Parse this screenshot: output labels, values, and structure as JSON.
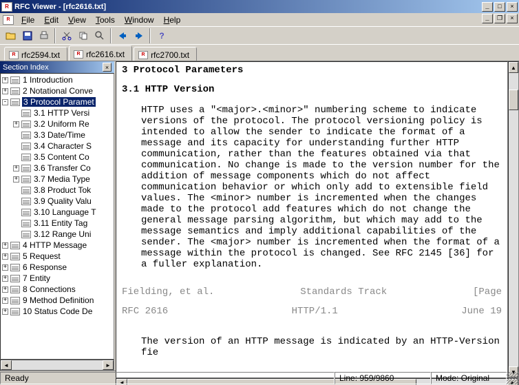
{
  "title": "RFC Viewer - [rfc2616.txt]",
  "menu": [
    "File",
    "Edit",
    "View",
    "Tools",
    "Window",
    "Help"
  ],
  "tabs": [
    "rfc2594.txt",
    "rfc2616.txt",
    "rfc2700.txt"
  ],
  "activeTab": 1,
  "sidebar": {
    "title": "Section Index",
    "items": [
      {
        "exp": "+",
        "lbl": "1 Introduction",
        "indent": 0
      },
      {
        "exp": "+",
        "lbl": "2 Notational Conve",
        "indent": 0
      },
      {
        "exp": "-",
        "lbl": "3 Protocol Paramet",
        "indent": 0,
        "sel": true
      },
      {
        "exp": "",
        "lbl": "3.1 HTTP Versi",
        "indent": 1
      },
      {
        "exp": "+",
        "lbl": "3.2 Uniform Re",
        "indent": 1
      },
      {
        "exp": "",
        "lbl": "3.3 Date/Time",
        "indent": 1
      },
      {
        "exp": "",
        "lbl": "3.4 Character S",
        "indent": 1
      },
      {
        "exp": "",
        "lbl": "3.5 Content Co",
        "indent": 1
      },
      {
        "exp": "+",
        "lbl": "3.6 Transfer Co",
        "indent": 1
      },
      {
        "exp": "+",
        "lbl": "3.7 Media Type",
        "indent": 1
      },
      {
        "exp": "",
        "lbl": "3.8 Product Tok",
        "indent": 1
      },
      {
        "exp": "",
        "lbl": "3.9 Quality Valu",
        "indent": 1
      },
      {
        "exp": "",
        "lbl": "3.10 Language T",
        "indent": 1
      },
      {
        "exp": "",
        "lbl": "3.11 Entity Tag",
        "indent": 1
      },
      {
        "exp": "",
        "lbl": "3.12 Range Uni",
        "indent": 1
      },
      {
        "exp": "+",
        "lbl": "4 HTTP Message",
        "indent": 0
      },
      {
        "exp": "+",
        "lbl": "5 Request",
        "indent": 0
      },
      {
        "exp": "+",
        "lbl": "6 Response",
        "indent": 0
      },
      {
        "exp": "+",
        "lbl": "7 Entity",
        "indent": 0
      },
      {
        "exp": "+",
        "lbl": "8 Connections",
        "indent": 0
      },
      {
        "exp": "+",
        "lbl": "9 Method Definition",
        "indent": 0
      },
      {
        "exp": "+",
        "lbl": "10 Status Code De",
        "indent": 0
      }
    ]
  },
  "content": {
    "h1": "3 Protocol Parameters",
    "h2": "3.1 HTTP Version",
    "para1": "HTTP uses a \"<major>.<minor>\" numbering scheme to indicate versions of the protocol. The protocol versioning policy is intended to allow the sender to indicate the format of a message and its capacity for understanding further HTTP communication, rather than the features obtained via that communication. No change is made to the version number for the addition of message components which do not affect communication behavior or which only add to extensible field values. The <minor> number is incremented when the changes made to the protocol add features which do not change the general message parsing algorithm, but which may add to the message semantics and imply additional capabilities of the sender. The <major> number is incremented when the format of a message within the protocol is changed. See RFC 2145 [36] for a fuller explanation.",
    "footer": {
      "left": "Fielding, et al.",
      "mid": "Standards Track",
      "right": "[Page"
    },
    "header": {
      "left": "RFC 2616",
      "mid": "HTTP/1.1",
      "right": "June 19"
    },
    "para2": "The version of an HTTP message is indicated by an HTTP-Version fie"
  },
  "status": {
    "ready": "Ready",
    "line": "Line: 959/9860",
    "mode": "Mode: Original"
  }
}
